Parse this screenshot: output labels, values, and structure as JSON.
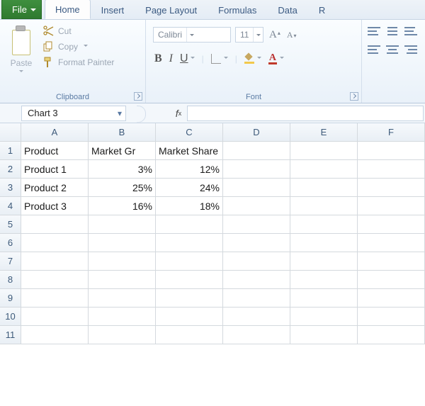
{
  "tabs": {
    "file": "File",
    "home": "Home",
    "insert": "Insert",
    "page_layout": "Page Layout",
    "formulas": "Formulas",
    "data": "Data",
    "r": "R"
  },
  "ribbon": {
    "clipboard": {
      "paste": "Paste",
      "cut": "Cut",
      "copy": "Copy",
      "format_painter": "Format Painter",
      "group_label": "Clipboard"
    },
    "font": {
      "name": "Calibri",
      "size": "11",
      "group_label": "Font",
      "bold": "B",
      "italic": "I",
      "underline": "U",
      "fontcolor_letter": "A"
    }
  },
  "bar": {
    "namebox": "Chart 3",
    "fx": "fx"
  },
  "columns": [
    "A",
    "B",
    "C",
    "D",
    "E",
    "F"
  ],
  "rows": [
    "1",
    "2",
    "3",
    "4",
    "5",
    "6",
    "7",
    "8",
    "9",
    "10",
    "11"
  ],
  "cells": {
    "A1": "Product",
    "B1": "Market Gr",
    "C1": "Market Share",
    "A2": "Product 1",
    "B2": "3%",
    "C2": "12%",
    "A3": "Product 2",
    "B3": "25%",
    "C3": "24%",
    "A4": "Product 3",
    "B4": "16%",
    "C4": "18%"
  },
  "chart_data": {
    "type": "table",
    "title": "",
    "columns": [
      "Product",
      "Market Gr",
      "Market Share"
    ],
    "rows": [
      {
        "Product": "Product 1",
        "Market Gr": 0.03,
        "Market Share": 0.12
      },
      {
        "Product": "Product 2",
        "Market Gr": 0.25,
        "Market Share": 0.24
      },
      {
        "Product": "Product 3",
        "Market Gr": 0.16,
        "Market Share": 0.18
      }
    ]
  }
}
